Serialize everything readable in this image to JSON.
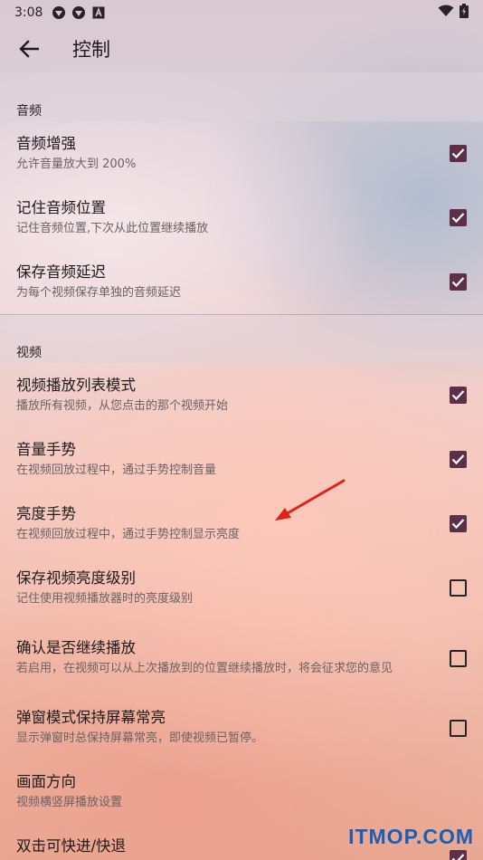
{
  "status_bar": {
    "time": "3:08",
    "battery_icon": "battery-charging-icon",
    "wifi_icon": "wifi-icon"
  },
  "app_bar": {
    "title": "控制",
    "back_icon": "arrow-back-icon"
  },
  "sections": {
    "audio": {
      "header": "音频",
      "items": [
        {
          "title": "音频增强",
          "summary": "允许音量放大到 200%",
          "checked": true
        },
        {
          "title": "记住音频位置",
          "summary": "记住音频位置,下次从此位置继续播放",
          "checked": true
        },
        {
          "title": "保存音频延迟",
          "summary": "为每个视频保存单独的音频延迟",
          "checked": true
        }
      ]
    },
    "video": {
      "header": "视频",
      "items": [
        {
          "title": "视频播放列表模式",
          "summary": "播放所有视频，从您点击的那个视频开始",
          "checked": true
        },
        {
          "title": "音量手势",
          "summary": "在视频回放过程中，通过手势控制音量",
          "checked": true
        },
        {
          "title": "亮度手势",
          "summary": "在视频回放过程中，通过手势控制显示亮度",
          "checked": true
        },
        {
          "title": "保存视频亮度级别",
          "summary": "记住使用视频播放器时的亮度级别",
          "checked": false
        },
        {
          "title": "确认是否继续播放",
          "summary": "若启用，在视频可以从上次播放到的位置继续播放时，将会征求您的意见",
          "checked": false
        },
        {
          "title": "弹窗模式保持屏幕常亮",
          "summary": "显示弹窗时总保持屏幕常亮，即使视频已暂停。",
          "checked": false
        },
        {
          "title": "画面方向",
          "summary": "视频横竖屏播放设置",
          "checked": null
        },
        {
          "title": "双击可快进/快退",
          "summary": "",
          "checked": true
        }
      ]
    }
  },
  "watermark": "ITMOP.COM",
  "colors": {
    "checkbox_on": "#5e2f49",
    "arrow": "#e0201b",
    "watermark": "#1b5fb4"
  }
}
